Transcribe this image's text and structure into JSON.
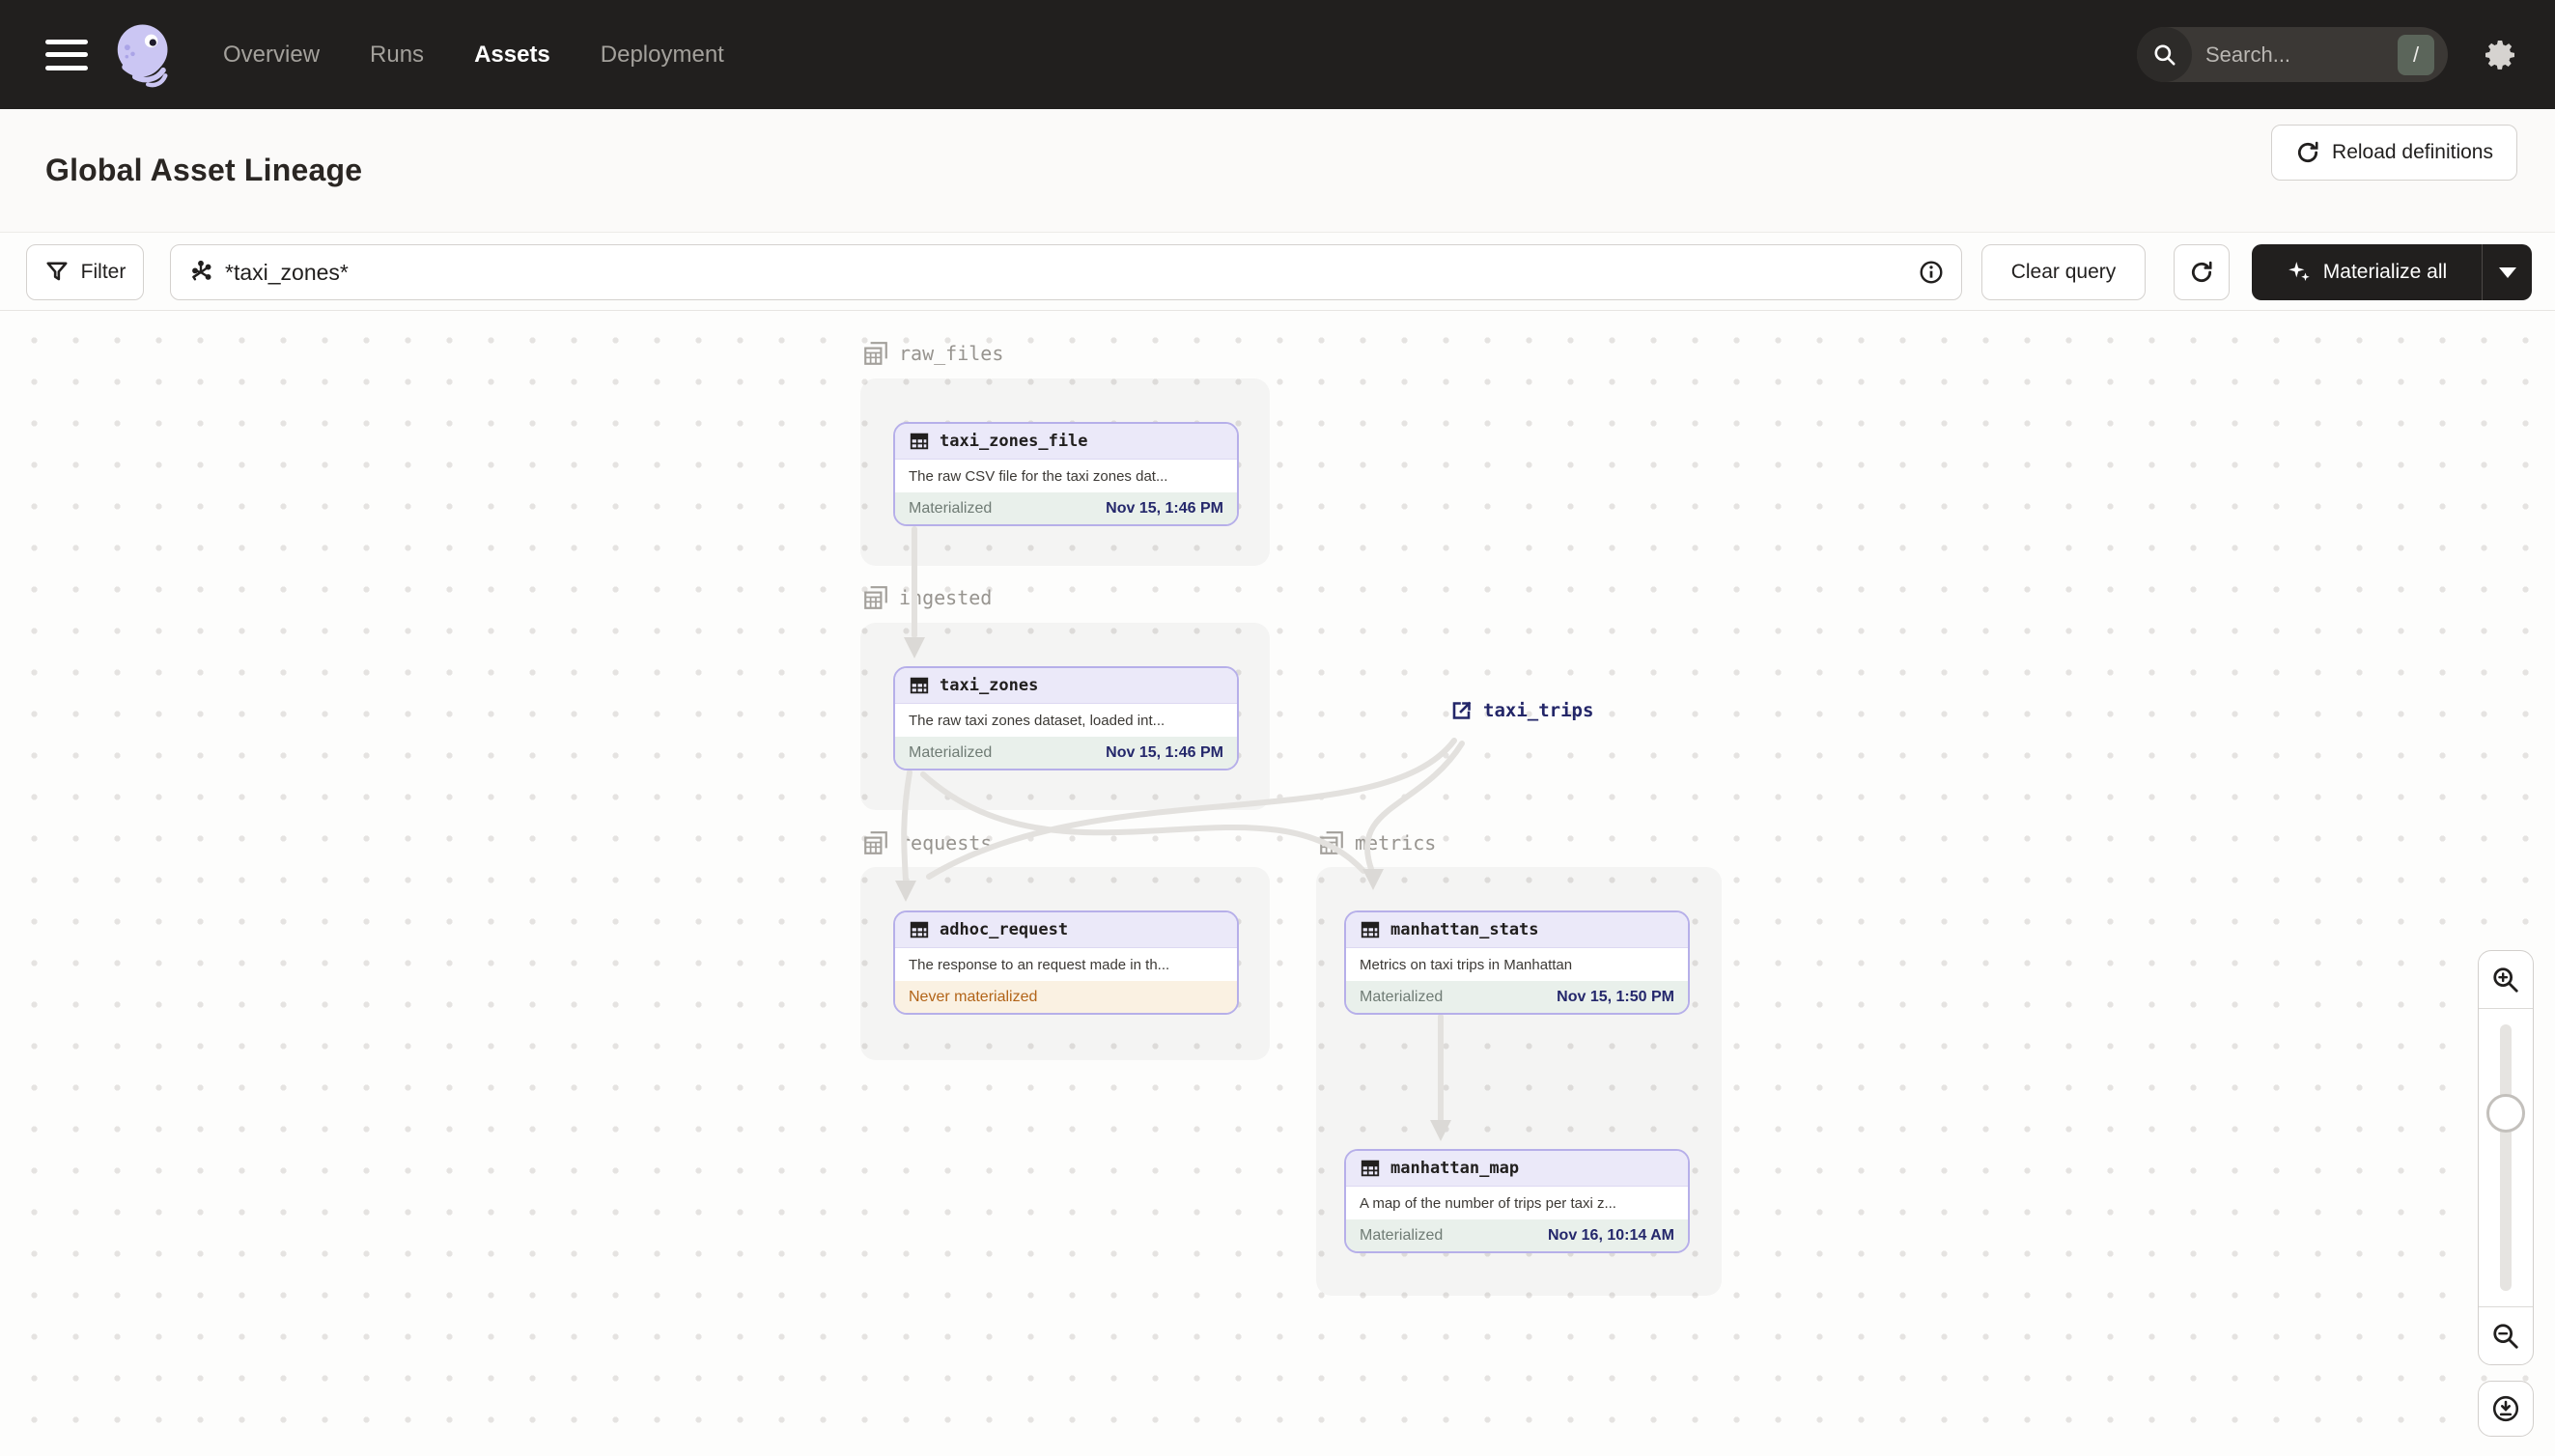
{
  "topbar": {
    "nav": [
      {
        "label": "Overview",
        "active": false
      },
      {
        "label": "Runs",
        "active": false
      },
      {
        "label": "Assets",
        "active": true
      },
      {
        "label": "Deployment",
        "active": false
      }
    ],
    "search": {
      "placeholder": "Search...",
      "shortcut": "/"
    }
  },
  "header": {
    "title": "Global Asset Lineage",
    "reload_label": "Reload definitions"
  },
  "toolbar": {
    "filter_label": "Filter",
    "query_value": "*taxi_zones*",
    "clear_label": "Clear query",
    "materialize_label": "Materialize all"
  },
  "graph": {
    "groups": [
      {
        "name": "raw_files"
      },
      {
        "name": "ingested"
      },
      {
        "name": "requests"
      },
      {
        "name": "metrics"
      }
    ],
    "nodes": [
      {
        "name": "taxi_zones_file",
        "description": "The raw CSV file for the taxi zones dat...",
        "status": "Materialized",
        "timestamp": "Nov 15, 1:46 PM"
      },
      {
        "name": "taxi_zones",
        "description": "The raw taxi zones dataset, loaded int...",
        "status": "Materialized",
        "timestamp": "Nov 15, 1:46 PM"
      },
      {
        "name": "adhoc_request",
        "description": "The response to an request made in th...",
        "status": "Never materialized",
        "timestamp": ""
      },
      {
        "name": "manhattan_stats",
        "description": "Metrics on taxi trips in Manhattan",
        "status": "Materialized",
        "timestamp": "Nov 15, 1:50 PM"
      },
      {
        "name": "manhattan_map",
        "description": "A map of the number of trips per taxi z...",
        "status": "Materialized",
        "timestamp": "Nov 16, 10:14 AM"
      }
    ],
    "external_node": {
      "name": "taxi_trips"
    }
  },
  "colors": {
    "topbar_bg": "#211F1E",
    "node_border_purple": "#B6AFE9",
    "node_header_purple": "#EBE9F9",
    "materialized_footer": "#E9F0EB",
    "never_materialized_footer": "#FAF1E2",
    "never_materialized_text": "#B26418",
    "timestamp_navy": "#24276B",
    "external_asset_navy": "#232668",
    "edge_gray": "#E3E1DE"
  }
}
